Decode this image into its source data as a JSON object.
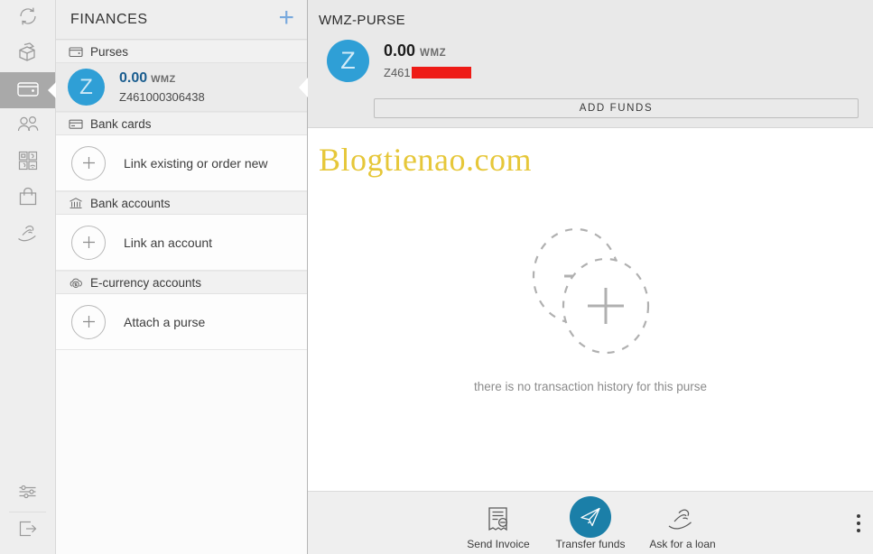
{
  "rail": {
    "items": [
      {
        "name": "exchange",
        "icon": "refresh-arrows-icon"
      },
      {
        "name": "inbox",
        "icon": "open-box-icon"
      },
      {
        "name": "finances",
        "icon": "wallet-icon",
        "active": true
      },
      {
        "name": "contacts",
        "icon": "people-icon"
      },
      {
        "name": "services",
        "icon": "services-grid-icon"
      },
      {
        "name": "shop",
        "icon": "shopping-bag-icon"
      },
      {
        "name": "loans",
        "icon": "hand-coin-icon"
      }
    ],
    "bottom": [
      {
        "name": "settings",
        "icon": "sliders-icon"
      },
      {
        "name": "logout",
        "icon": "exit-arrow-icon"
      }
    ]
  },
  "sidebar": {
    "title": "FINANCES",
    "add_label": "+",
    "groups": [
      {
        "label": "Purses",
        "icon": "purse-icon",
        "purse": {
          "avatar_letter": "Z",
          "amount": "0.00",
          "currency": "WMZ",
          "id": "Z461000306438"
        }
      },
      {
        "label": "Bank cards",
        "icon": "bank-card-icon",
        "action": "Link existing or order new"
      },
      {
        "label": "Bank accounts",
        "icon": "bank-building-icon",
        "action": "Link an account"
      },
      {
        "label": "E-currency accounts",
        "icon": "cloud-dollar-icon",
        "action": "Attach a purse"
      }
    ]
  },
  "main": {
    "title": "WMZ-PURSE",
    "purse": {
      "avatar_letter": "Z",
      "amount": "0.00",
      "currency": "WMZ",
      "id_prefix": "Z461",
      "id_redacted": true
    },
    "add_funds_label": "ADD FUNDS",
    "watermark": "Blogtienao.com",
    "empty_text": "there is no transaction history for this purse"
  },
  "bottombar": {
    "actions": [
      {
        "label": "Send Invoice",
        "icon": "invoice-icon",
        "primary": false
      },
      {
        "label": "Transfer funds",
        "icon": "paper-plane-icon",
        "primary": true
      },
      {
        "label": "Ask for a loan",
        "icon": "hand-coin-icon",
        "primary": false
      }
    ],
    "menu_icon": "kebab-menu-icon"
  },
  "colors": {
    "accent_blue": "#2f9fd6",
    "primary_button": "#1b7fa8",
    "amount_blue": "#1a5d8f",
    "plus_blue": "#78a9dd",
    "watermark_gold": "#e6c739",
    "redaction_red": "#ee1b16"
  }
}
